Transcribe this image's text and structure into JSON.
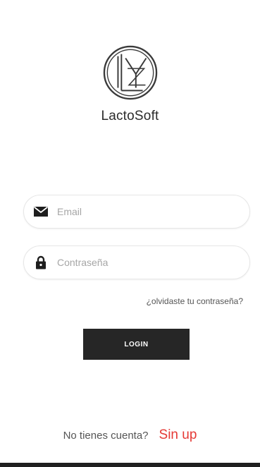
{
  "app": {
    "name": "LactoSoft"
  },
  "login_form": {
    "email_placeholder": "Email",
    "email_value": "",
    "email_icon": "envelope-icon",
    "password_placeholder": "Contraseña",
    "password_value": "",
    "password_icon": "lock-icon",
    "forgot_password_label": "¿olvidaste tu contraseña?",
    "login_button_label": "LOGIN"
  },
  "signup": {
    "prompt": "No tienes cuenta?",
    "link_label": "Sin up"
  },
  "colors": {
    "background": "#ffffff",
    "button": "#262626",
    "signup_link": "#e53935",
    "placeholder": "#a6a6a6"
  }
}
